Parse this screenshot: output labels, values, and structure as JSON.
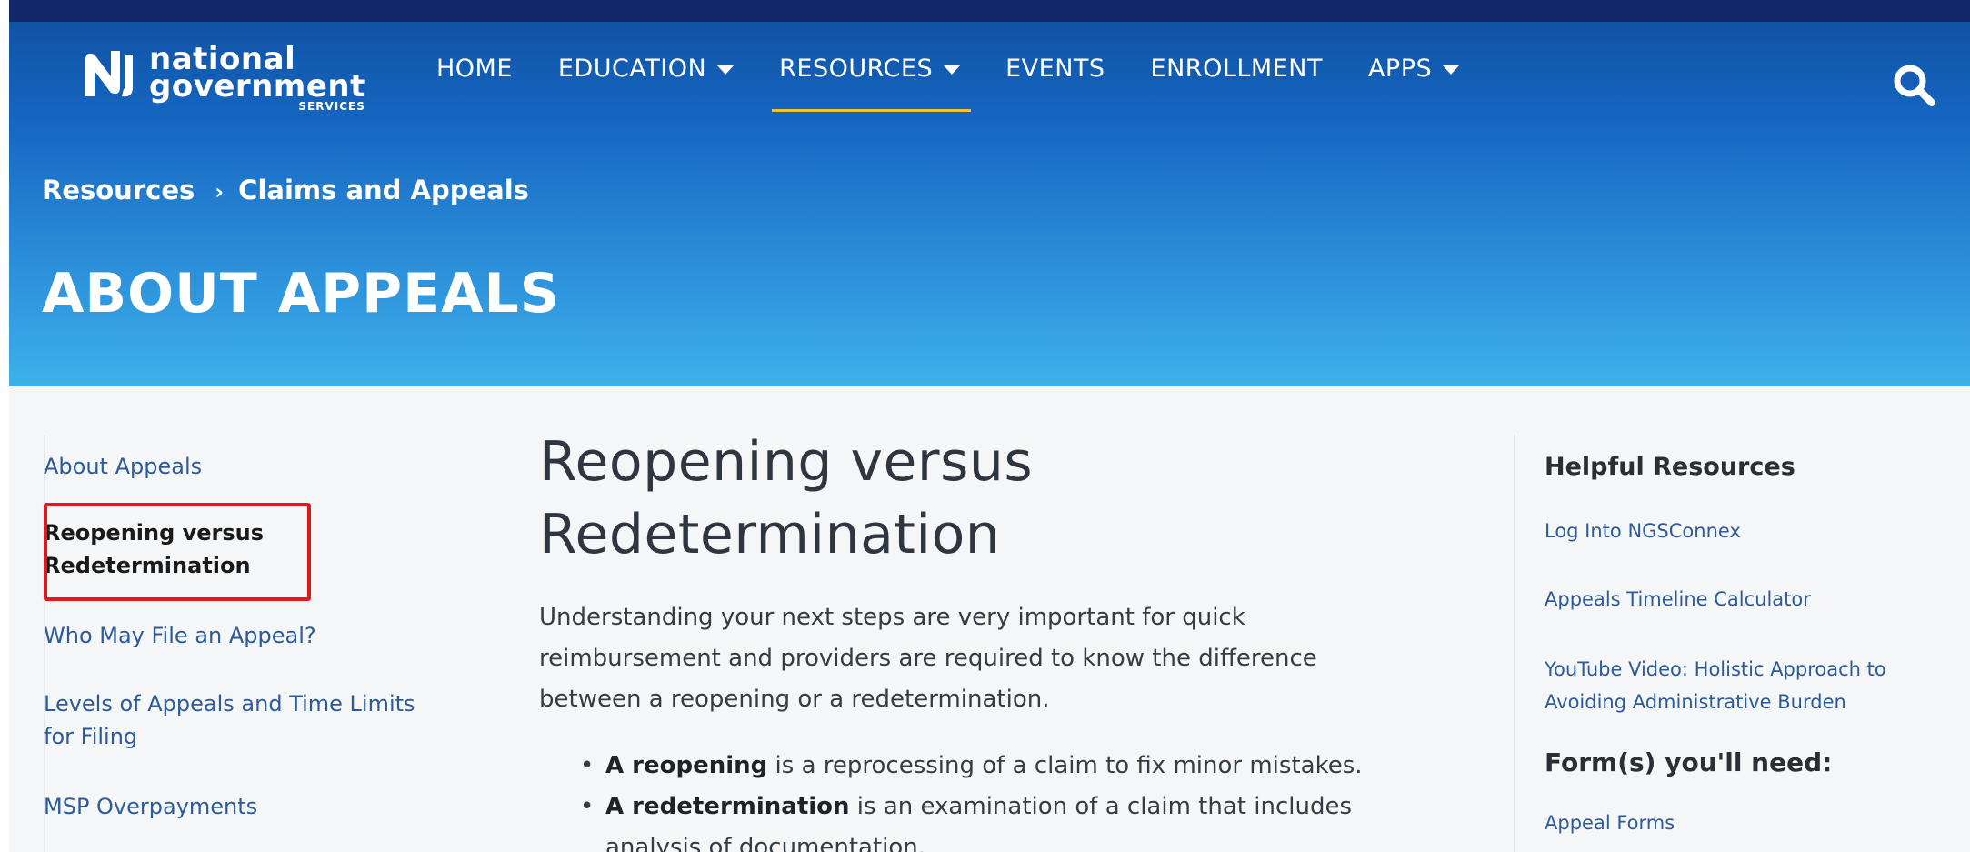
{
  "header": {
    "logo": {
      "line1": "national",
      "line2": "government",
      "line3": "SERVICES"
    },
    "nav": [
      {
        "label": "HOME",
        "dropdown": false
      },
      {
        "label": "EDUCATION",
        "dropdown": true
      },
      {
        "label": "RESOURCES",
        "dropdown": true,
        "active": true
      },
      {
        "label": "EVENTS",
        "dropdown": false
      },
      {
        "label": "ENROLLMENT",
        "dropdown": false
      },
      {
        "label": "APPS",
        "dropdown": true
      }
    ],
    "search_icon": "search-icon"
  },
  "breadcrumb": {
    "items": [
      "Resources",
      "Claims and Appeals"
    ],
    "separator": "›"
  },
  "page_title": "ABOUT APPEALS",
  "left_nav": {
    "items": [
      {
        "label": "About Appeals"
      },
      {
        "label": "Reopening versus",
        "label2": "Redetermination",
        "current": true
      },
      {
        "label": "Who May File an Appeal?"
      },
      {
        "label": "Levels of Appeals and Time Limits",
        "label2": "for Filing"
      },
      {
        "label": "MSP Overpayments"
      }
    ]
  },
  "main": {
    "heading_line1": "Reopening versus",
    "heading_line2": "Redetermination",
    "para_line1": "Understanding your next steps are very important for quick",
    "para_line2": "reimbursement and providers are required to know the difference",
    "para_line3": "between a reopening or a redetermination.",
    "bullets": [
      {
        "bold": "A reopening",
        "text": " is a reprocessing of a claim to fix minor mistakes."
      },
      {
        "bold": "A redetermination",
        "text": " is an examination of a claim that includes",
        "text2": "analysis of documentation."
      }
    ]
  },
  "right_sidebar": {
    "heading": "Helpful Resources",
    "links": [
      {
        "label": "Log Into NGSConnex"
      },
      {
        "label": "Appeals Timeline Calculator"
      },
      {
        "label": "YouTube Video: Holistic Approach to",
        "label2": "Avoiding Administrative Burden"
      }
    ],
    "forms_heading": "Form(s) you'll need:",
    "forms_links": [
      {
        "label": "Appeal Forms"
      }
    ]
  },
  "colors": {
    "header_dark": "#13286a",
    "header_blue": "#1565c0",
    "header_light": "#3db1ea",
    "active_underline": "#f2c230",
    "link": "#2d5b9a",
    "highlight_box": "#e01818"
  }
}
